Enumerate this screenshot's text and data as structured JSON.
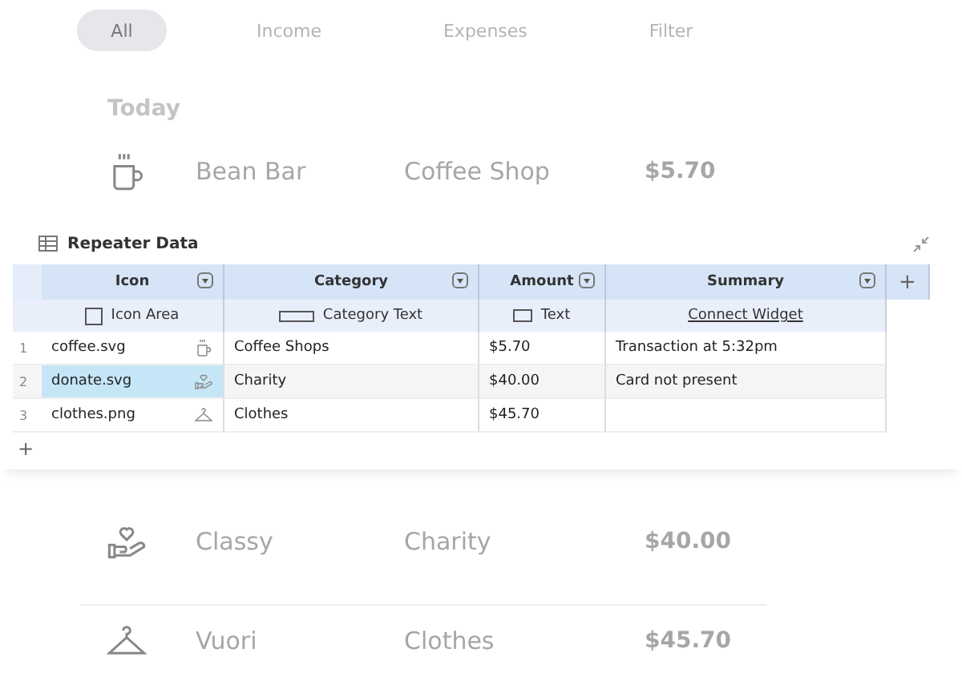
{
  "tabs": [
    {
      "label": "All",
      "selected": true
    },
    {
      "label": "Income",
      "selected": false
    },
    {
      "label": "Expenses",
      "selected": false
    },
    {
      "label": "Filter",
      "selected": false
    }
  ],
  "section_title": "Today",
  "transactions_top": [
    {
      "kind": "mug",
      "name": "Bean Bar",
      "category": "Coffee Shop",
      "amount": "$5.70"
    }
  ],
  "repeater": {
    "title": "Repeater Data",
    "add_column": "+",
    "add_row": "+",
    "columns": [
      {
        "label": "Icon",
        "binding": "Icon Area",
        "kind": "square"
      },
      {
        "label": "Category",
        "binding": "Category Text",
        "kind": "wide"
      },
      {
        "label": "Amount",
        "binding": "Text",
        "kind": "rect"
      },
      {
        "label": "Summary",
        "binding": "Connect Widget",
        "kind": "link"
      }
    ],
    "rows": [
      {
        "number": "1",
        "file": "coffee.svg",
        "kind": "mug",
        "category": "Coffee Shops",
        "amount": "$5.70",
        "summary": "Transaction at 5:32pm",
        "selected": false
      },
      {
        "number": "2",
        "file": "donate.svg",
        "kind": "hand-heart",
        "category": "Charity",
        "amount": "$40.00",
        "summary": "Card not present",
        "selected": true
      },
      {
        "number": "3",
        "file": "clothes.png",
        "kind": "hanger",
        "category": "Clothes",
        "amount": "$45.70",
        "selected": false
      }
    ]
  },
  "transactions_bottom": [
    {
      "kind": "hand-heart",
      "name": "Classy",
      "category": "Charity",
      "amount": "$40.00"
    },
    {
      "kind": "hanger",
      "name": "Vuori",
      "category": "Clothes",
      "amount": "$45.70"
    }
  ]
}
